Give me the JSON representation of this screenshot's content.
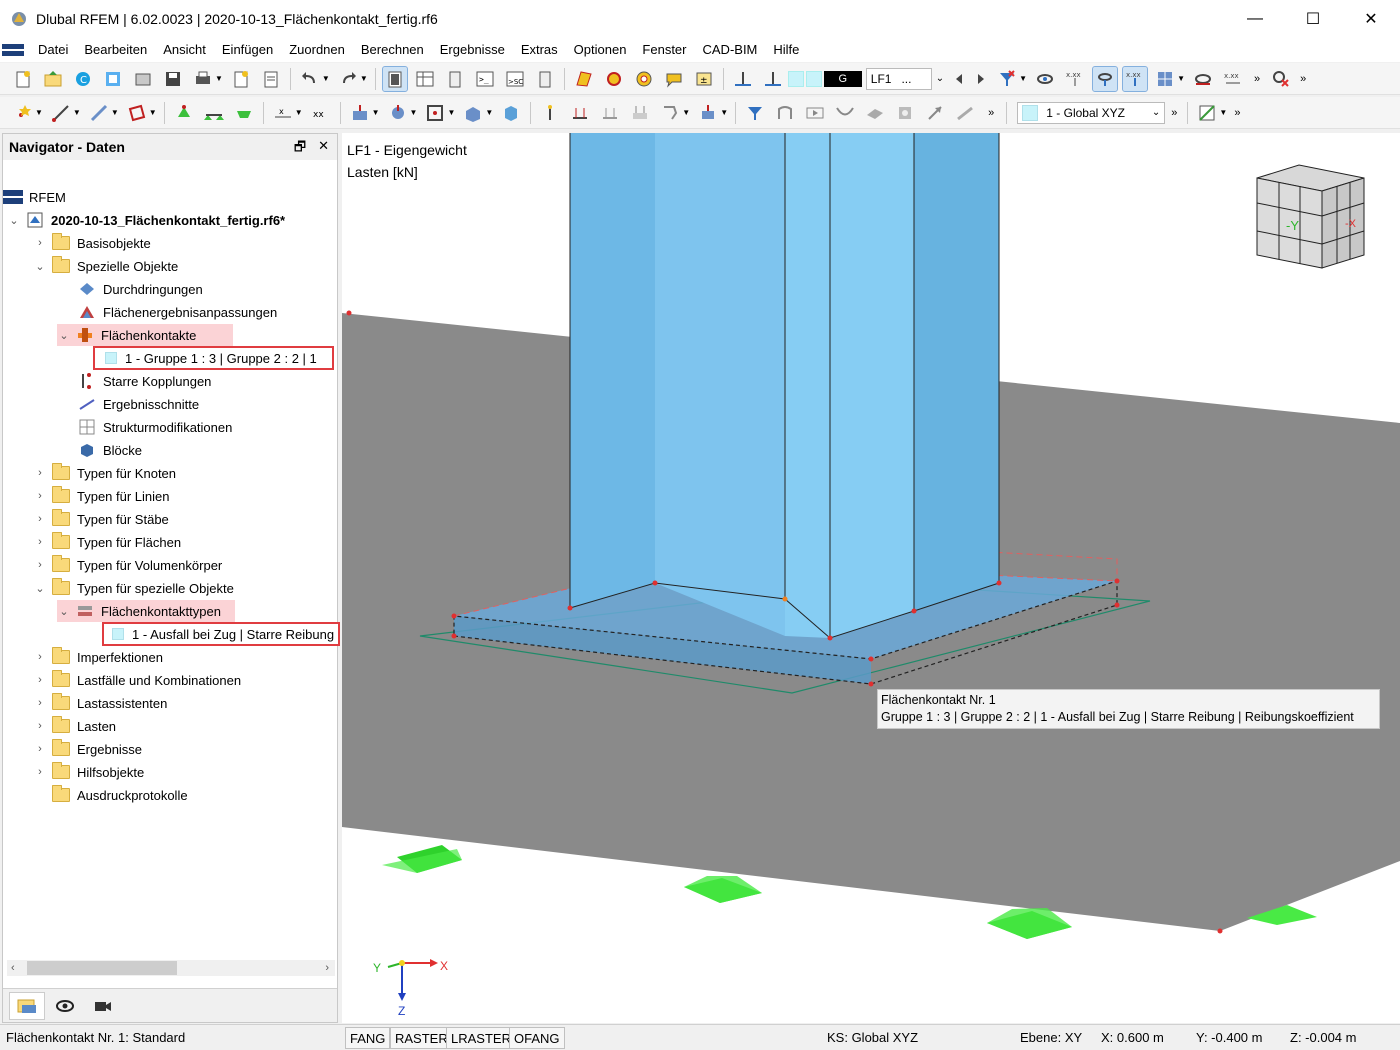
{
  "window": {
    "title": "Dlubal RFEM | 6.02.0023 | 2020-10-13_Flächenkontakt_fertig.rf6",
    "minimize": "—",
    "maximize": "☐",
    "close": "✕"
  },
  "menu": [
    "Datei",
    "Bearbeiten",
    "Ansicht",
    "Einfügen",
    "Zuordnen",
    "Berechnen",
    "Ergebnisse",
    "Extras",
    "Optionen",
    "Fenster",
    "CAD-BIM",
    "Hilfe"
  ],
  "toolbar1": {
    "loadcase_code": "G",
    "loadcase_name": "LF1",
    "loadcase_more": "..."
  },
  "toolbar2": {
    "coord_system": "1 - Global XYZ"
  },
  "navigator": {
    "title": "Navigator - Daten",
    "root": "RFEM",
    "file": "2020-10-13_Flächenkontakt_fertig.rf6*",
    "items": {
      "basis": "Basisobjekte",
      "spezielle": "Spezielle Objekte",
      "durchdringungen": "Durchdringungen",
      "anpassungen": "Flächenergebnisanpassungen",
      "flaechenkontakte": "Flächenkontakte",
      "kontakt1": "1 - Gruppe 1 : 3 | Gruppe 2 : 2 | 1",
      "kopplungen": "Starre Kopplungen",
      "schnitte": "Ergebnisschnitte",
      "strukturmod": "Strukturmodifikationen",
      "bloecke": "Blöcke",
      "typen_knoten": "Typen für Knoten",
      "typen_linien": "Typen für Linien",
      "typen_staebe": "Typen für Stäbe",
      "typen_flaechen": "Typen für Flächen",
      "typen_volumen": "Typen für Volumenkörper",
      "typen_spezielle": "Typen für spezielle Objekte",
      "kontakttypen": "Flächenkontakttypen",
      "kontakttyp1": "1 - Ausfall bei Zug | Starre Reibung",
      "imperfektionen": "Imperfektionen",
      "lastfaelle": "Lastfälle und Kombinationen",
      "lastassistenten": "Lastassistenten",
      "lasten": "Lasten",
      "ergebnisse": "Ergebnisse",
      "hilfsobjekte": "Hilfsobjekte",
      "ausdruck": "Ausdruckprotokolle"
    }
  },
  "viewport": {
    "loadcase_label": "LF1 - Eigengewicht",
    "units_label": "Lasten [kN]",
    "tooltip_line1": "Flächenkontakt Nr. 1",
    "tooltip_line2": "Gruppe 1 : 3 | Gruppe 2 : 2 | 1 - Ausfall bei Zug | Starre Reibung | Reibungskoeffizient",
    "axis_x": "X",
    "axis_y": "Y",
    "axis_z": "Z",
    "cube_y": "-Y",
    "cube_x": "-X"
  },
  "statusbar": {
    "message": "Flächenkontakt Nr. 1: Standard",
    "fang": "FANG",
    "raster": "RASTER",
    "lraster": "LRASTER",
    "ofang": "OFANG",
    "ks": "KS: Global XYZ",
    "ebene": "Ebene: XY",
    "x": "X: 0.600 m",
    "y": "Y: -0.400 m",
    "z": "Z: -0.004 m"
  },
  "colors": {
    "column_face": "#6bb5e0",
    "column_front": "#8fd0f5",
    "slab": "#8b8b8b",
    "support": "#3fe03c",
    "highlight": "#fbd3d6",
    "highlight_border": "#e03c40"
  }
}
